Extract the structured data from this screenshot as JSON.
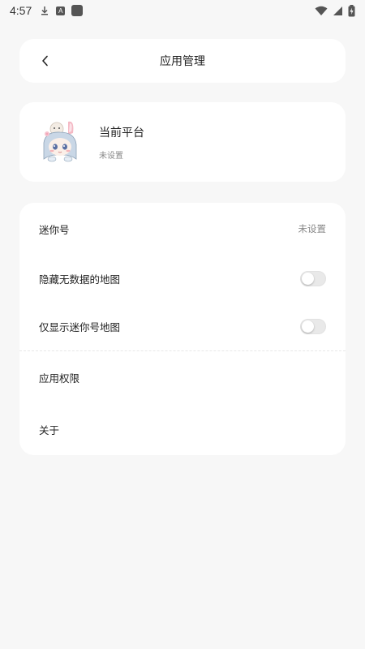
{
  "status_bar": {
    "time": "4:57",
    "left_icons": [
      "download-icon",
      "a-icon",
      "square-icon"
    ],
    "right_icons": [
      "wifi-icon",
      "signal-icon",
      "battery-charging-icon"
    ]
  },
  "header": {
    "title": "应用管理",
    "back_icon": "chevron-left-icon"
  },
  "platform": {
    "title": "当前平台",
    "subtitle": "未设置"
  },
  "settings": {
    "rows": [
      {
        "label": "迷你号",
        "value": "未设置"
      },
      {
        "label": "隐藏无数据的地图",
        "toggle": false
      },
      {
        "label": "仅显示迷你号地图",
        "toggle": false
      },
      {
        "label": "应用权限"
      },
      {
        "label": "关于"
      }
    ]
  },
  "colors": {
    "background": "#f7f7f7",
    "card": "#ffffff",
    "text_primary": "#222222",
    "text_secondary": "#888888",
    "toggle_off": "#e9e9e9"
  }
}
